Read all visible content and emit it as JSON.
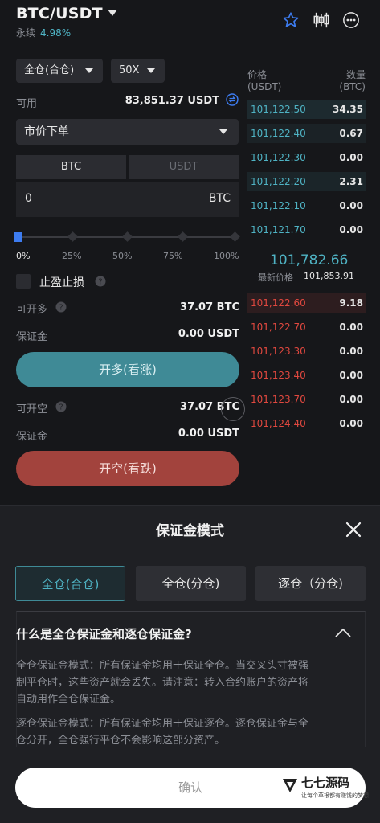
{
  "header": {
    "pair": "BTC/USDT",
    "contract_type": "永续",
    "change": "4.98%"
  },
  "icons": {
    "star": "star-icon",
    "chart": "candlestick-chart-icon",
    "more": "more-icon"
  },
  "order_form": {
    "margin_mode": "全仓(合仓)",
    "leverage": "50X",
    "available_label": "可用",
    "available_value": "83,851.37 USDT",
    "order_type": "市价下单",
    "unit_tabs": [
      "BTC",
      "USDT"
    ],
    "amount_value": "0",
    "amount_unit": "BTC",
    "slider_percent": 0,
    "slider_marks": [
      "0%",
      "25%",
      "50%",
      "75%",
      "100%"
    ],
    "tpsl_label": "止盈止损",
    "long": {
      "openable_label": "可开多",
      "openable_value": "37.07 BTC",
      "margin_label": "保证金",
      "margin_value": "0.00 USDT",
      "button": "开多(看涨)"
    },
    "short": {
      "openable_label": "可开空",
      "openable_value": "37.07 BTC",
      "margin_label": "保证金",
      "margin_value": "0.00 USDT",
      "button": "开空(看跌)"
    }
  },
  "orderbook": {
    "price_header": "价格",
    "price_unit": "(USDT)",
    "qty_header": "数量",
    "qty_unit": "(BTC)",
    "bids": [
      {
        "price": "101,122.50",
        "qty": "34.35"
      },
      {
        "price": "101,122.40",
        "qty": "0.67"
      },
      {
        "price": "101,122.30",
        "qty": "0.00"
      },
      {
        "price": "101,122.20",
        "qty": "2.31"
      },
      {
        "price": "101,122.10",
        "qty": "0.00"
      },
      {
        "price": "101,121.70",
        "qty": "0.00"
      }
    ],
    "mid_price": "101,782.66",
    "last_price_label": "最新价格",
    "last_price": "101,853.91",
    "asks": [
      {
        "price": "101,122.60",
        "qty": "9.18"
      },
      {
        "price": "101,122.70",
        "qty": "0.00"
      },
      {
        "price": "101,123.30",
        "qty": "0.00"
      },
      {
        "price": "101,123.40",
        "qty": "0.00"
      },
      {
        "price": "101,123.70",
        "qty": "0.00"
      },
      {
        "price": "101,124.40",
        "qty": "0.00"
      }
    ]
  },
  "modal": {
    "title": "保证金模式",
    "tabs": [
      "全仓(合仓)",
      "全仓(分仓)",
      "逐仓（分仓)"
    ],
    "active_tab": 0,
    "faq_title": "什么是全仓保证金和逐仓保证金?",
    "para1_lines": [
      "全仓保证金模式：所有保证金均用于保证全仓。当交叉头寸被强",
      "制平仓时，这些资产就会丢失。请注意：转入合约账户的资产将",
      "自动用作全仓保证金。"
    ],
    "para2_lines": [
      "逐仓保证金模式：所有保证金均用于保证逐仓。逐仓保证金与全",
      "仓分开，全仓强行平仓不会影响这部分资产。"
    ],
    "confirm": "确认",
    "watermark": "七七源码",
    "watermark_sub": "让每个草根都有赚钱的梦想"
  },
  "colors": {
    "accent_teal": "#3f8a96",
    "bid_price": "#4fb3c4",
    "ask_price": "#e0483f",
    "short_red": "#a2433d"
  }
}
